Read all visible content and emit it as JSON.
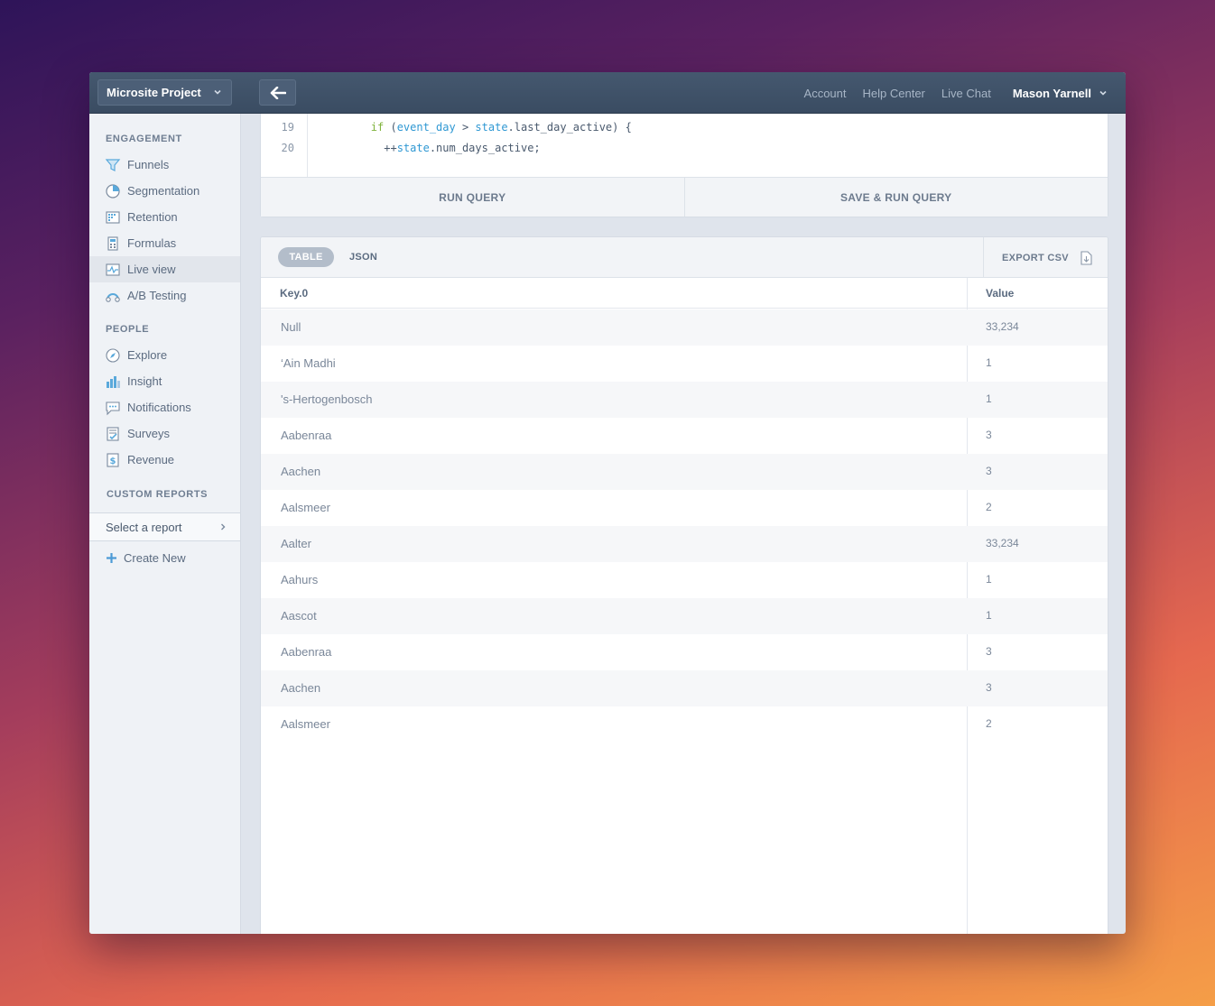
{
  "header": {
    "project_name": "Microsite Project",
    "links": [
      "Account",
      "Help Center",
      "Live Chat"
    ],
    "user_name": "Mason Yarnell"
  },
  "sidebar": {
    "engagement_title": "ENGAGEMENT",
    "engagement_items": [
      {
        "label": "Funnels",
        "icon": "funnel-icon"
      },
      {
        "label": "Segmentation",
        "icon": "pie-chart-icon"
      },
      {
        "label": "Retention",
        "icon": "grid-icon"
      },
      {
        "label": "Formulas",
        "icon": "calculator-icon"
      },
      {
        "label": "Live view",
        "icon": "pulse-icon",
        "active": true
      },
      {
        "label": "A/B Testing",
        "icon": "ab-test-icon"
      }
    ],
    "people_title": "PEOPLE",
    "people_items": [
      {
        "label": "Explore",
        "icon": "compass-icon"
      },
      {
        "label": "Insight",
        "icon": "bar-chart-icon"
      },
      {
        "label": "Notifications",
        "icon": "chat-bubble-icon"
      },
      {
        "label": "Surveys",
        "icon": "checklist-icon"
      },
      {
        "label": "Revenue",
        "icon": "dollar-icon"
      }
    ],
    "custom_title": "CUSTOM REPORTS",
    "select_report": "Select a report",
    "create_new": "Create New"
  },
  "code": {
    "lines": [
      {
        "number": "19",
        "indent": "        ",
        "parts": [
          [
            "kw",
            "if"
          ],
          [
            "plain",
            " ("
          ],
          [
            "var",
            "event_day"
          ],
          [
            "plain",
            " > "
          ],
          [
            "var",
            "state"
          ],
          [
            "plain",
            ".last_day_active) {"
          ]
        ]
      },
      {
        "number": "20",
        "indent": "          ",
        "parts": [
          [
            "plain",
            "++"
          ],
          [
            "var",
            "state"
          ],
          [
            "plain",
            ".num_days_active;"
          ]
        ]
      }
    ],
    "run_label": "RUN QUERY",
    "save_run_label": "SAVE & RUN QUERY"
  },
  "results": {
    "tab_table": "TABLE",
    "tab_json": "JSON",
    "export_label": "EXPORT CSV",
    "columns": [
      "Key.0",
      "Value"
    ],
    "rows": [
      [
        "Null",
        "33,234"
      ],
      [
        "‘Ain Madhi",
        "1"
      ],
      [
        "'s-Hertogenbosch",
        "1"
      ],
      [
        "Aabenraa",
        "3"
      ],
      [
        "Aachen",
        "3"
      ],
      [
        "Aalsmeer",
        "2"
      ],
      [
        "Aalter",
        "33,234"
      ],
      [
        "Aahurs",
        "1"
      ],
      [
        "Aascot",
        "1"
      ],
      [
        "Aabenraa",
        "3"
      ],
      [
        "Aachen",
        "3"
      ],
      [
        "Aalsmeer",
        "2"
      ]
    ]
  },
  "colors": {
    "accent": "#2f98d3",
    "keyword": "#7fb33c",
    "topbar": "#3f5168"
  }
}
